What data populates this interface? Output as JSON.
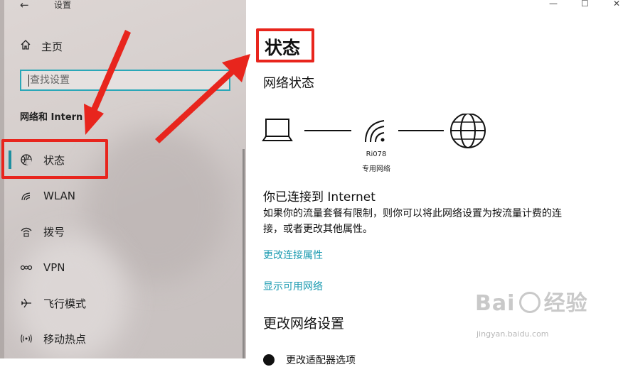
{
  "window": {
    "title": "设置",
    "back_glyph": "←",
    "minimize_glyph": "—",
    "maximize_glyph": "☐",
    "close_glyph": "✕"
  },
  "sidebar": {
    "home_label": "主页",
    "search_placeholder": "查找设置",
    "section_title": "网络和 Intern",
    "items": [
      {
        "label": "状态",
        "icon": "globe-icon",
        "active": true
      },
      {
        "label": "WLAN",
        "icon": "wifi-icon"
      },
      {
        "label": "拨号",
        "icon": "dialup-icon"
      },
      {
        "label": "VPN",
        "icon": "vpn-icon"
      },
      {
        "label": "飞行模式",
        "icon": "airplane-icon"
      },
      {
        "label": "移动热点",
        "icon": "hotspot-icon"
      }
    ]
  },
  "main": {
    "title": "状态",
    "network_status_heading": "网络状态",
    "network_name": "Ri078",
    "network_type": "专用网络",
    "connected_text": "你已连接到 Internet",
    "description": "如果你的流量套餐有限制，则你可以将此网络设置为按流量计费的连接，或者更改其他属性。",
    "link_change_properties": "更改连接属性",
    "link_show_networks": "显示可用网络",
    "change_settings_heading": "更改网络设置",
    "partial_item": "更改适配器选项"
  },
  "watermark": {
    "text": "Bai",
    "text2": "经验",
    "sub": "jingyan.baidu.com"
  },
  "colors": {
    "accent": "#1a9ab0",
    "annotation": "#e8251d",
    "search_border": "#2aa7b8"
  }
}
